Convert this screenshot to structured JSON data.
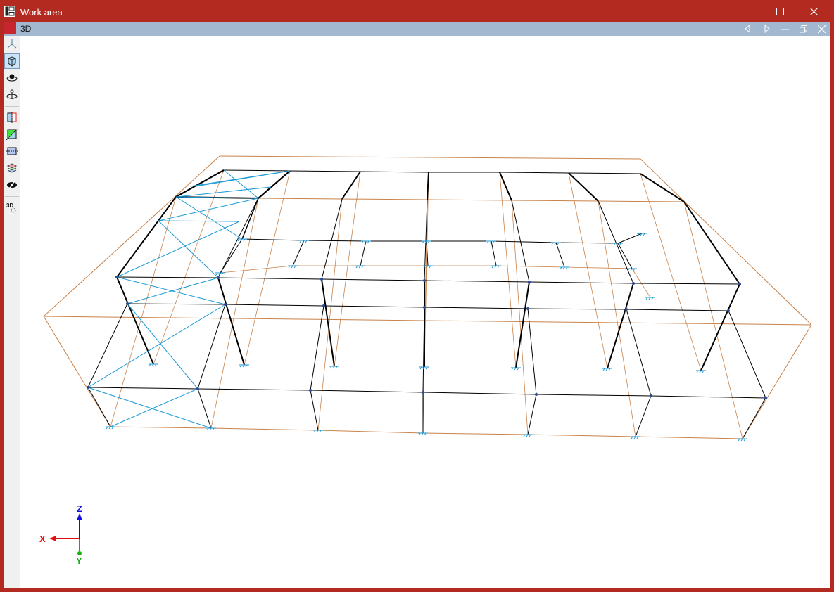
{
  "window": {
    "title": "Work area",
    "maximize_icon": "maximize-icon",
    "close_icon": "close-icon"
  },
  "view": {
    "title": "3D"
  },
  "colors": {
    "frame": "#b22a20",
    "subbar": "#a2b8cf",
    "beams": "#000000",
    "bracing": "#1a9ad6",
    "tie": "#c8824a",
    "axis_x": "#e01010",
    "axis_y": "#10b010",
    "axis_z": "#1010e0"
  },
  "axes": {
    "x": "X",
    "y": "Y",
    "z": "Z"
  },
  "toolbar": [
    "axes-icon",
    "view-cube-icon",
    "orbit-icon",
    "rotate-icon",
    "section-vertical-icon",
    "section-diagonal-icon",
    "section-horizontal-icon",
    "layers-icon",
    "hide-icon",
    "3d-settings-icon"
  ]
}
